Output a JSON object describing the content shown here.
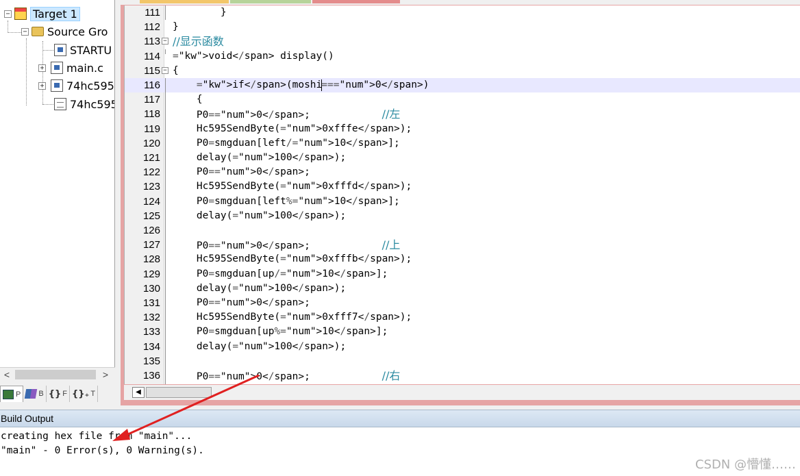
{
  "project_tree": {
    "items": [
      {
        "label": "Target 1",
        "icon": "target-icon",
        "expander": "⊟"
      },
      {
        "label": "Source Gro",
        "icon": "folder-icon",
        "expander": "⊟"
      },
      {
        "label": "STARTU",
        "icon": "asm-file-icon",
        "expander": ""
      },
      {
        "label": "main.c",
        "icon": "c-file-icon",
        "expander": "⊞"
      },
      {
        "label": "74hc595",
        "icon": "c-file-icon",
        "expander": "⊞"
      },
      {
        "label": "74hc595",
        "icon": "header-file-icon",
        "expander": ""
      }
    ],
    "scroll_left": "<",
    "scroll_right": ">"
  },
  "panel_tabs": [
    {
      "glyph": "",
      "label": "P",
      "icon": "project-icon"
    },
    {
      "glyph": "",
      "label": "B",
      "icon": "books-icon"
    },
    {
      "glyph": "{}",
      "label": "F",
      "icon": "functions-icon"
    },
    {
      "glyph": "{}₊",
      "label": "T",
      "icon": "templates-icon"
    }
  ],
  "editor": {
    "current_line": "116",
    "lines": [
      {
        "n": "111",
        "code": "        }"
      },
      {
        "n": "112",
        "code": "}"
      },
      {
        "n": "113",
        "code": "//显示函数"
      },
      {
        "n": "114",
        "code": "void display()"
      },
      {
        "n": "115",
        "code": "{"
      },
      {
        "n": "116",
        "code": "    if(moshi==0)"
      },
      {
        "n": "117",
        "code": "    {"
      },
      {
        "n": "118",
        "code": "    P0=0;            //左"
      },
      {
        "n": "119",
        "code": "    Hc595SendByte(0xfffe);"
      },
      {
        "n": "120",
        "code": "    P0=smgduan[left/10];"
      },
      {
        "n": "121",
        "code": "    delay(100);"
      },
      {
        "n": "122",
        "code": "    P0=0;"
      },
      {
        "n": "123",
        "code": "    Hc595SendByte(0xfffd);"
      },
      {
        "n": "124",
        "code": "    P0=smgduan[left%10];"
      },
      {
        "n": "125",
        "code": "    delay(100);"
      },
      {
        "n": "126",
        "code": ""
      },
      {
        "n": "127",
        "code": "    P0=0;            //上"
      },
      {
        "n": "128",
        "code": "    Hc595SendByte(0xfffb);"
      },
      {
        "n": "129",
        "code": "    P0=smgduan[up/10];"
      },
      {
        "n": "130",
        "code": "    delay(100);"
      },
      {
        "n": "131",
        "code": "    P0=0;"
      },
      {
        "n": "132",
        "code": "    Hc595SendByte(0xfff7);"
      },
      {
        "n": "133",
        "code": "    P0=smgduan[up%10];"
      },
      {
        "n": "134",
        "code": "    delay(100);"
      },
      {
        "n": "135",
        "code": ""
      },
      {
        "n": "136",
        "code": "    P0=0;            //右"
      }
    ],
    "scroll_left": "◀"
  },
  "build_output": {
    "title": "Build Output",
    "lines": [
      "creating hex file from \"main\"...",
      "\"main\" - 0 Error(s), 0 Warning(s)."
    ]
  },
  "watermark": "CSDN @懵懂……",
  "colors": {
    "editor_frame": "#e6a4a4",
    "current_line": "#e8e8ff",
    "comment": "#2a8aa0",
    "number": "#7a2a9a",
    "arrow": "#e02020"
  }
}
